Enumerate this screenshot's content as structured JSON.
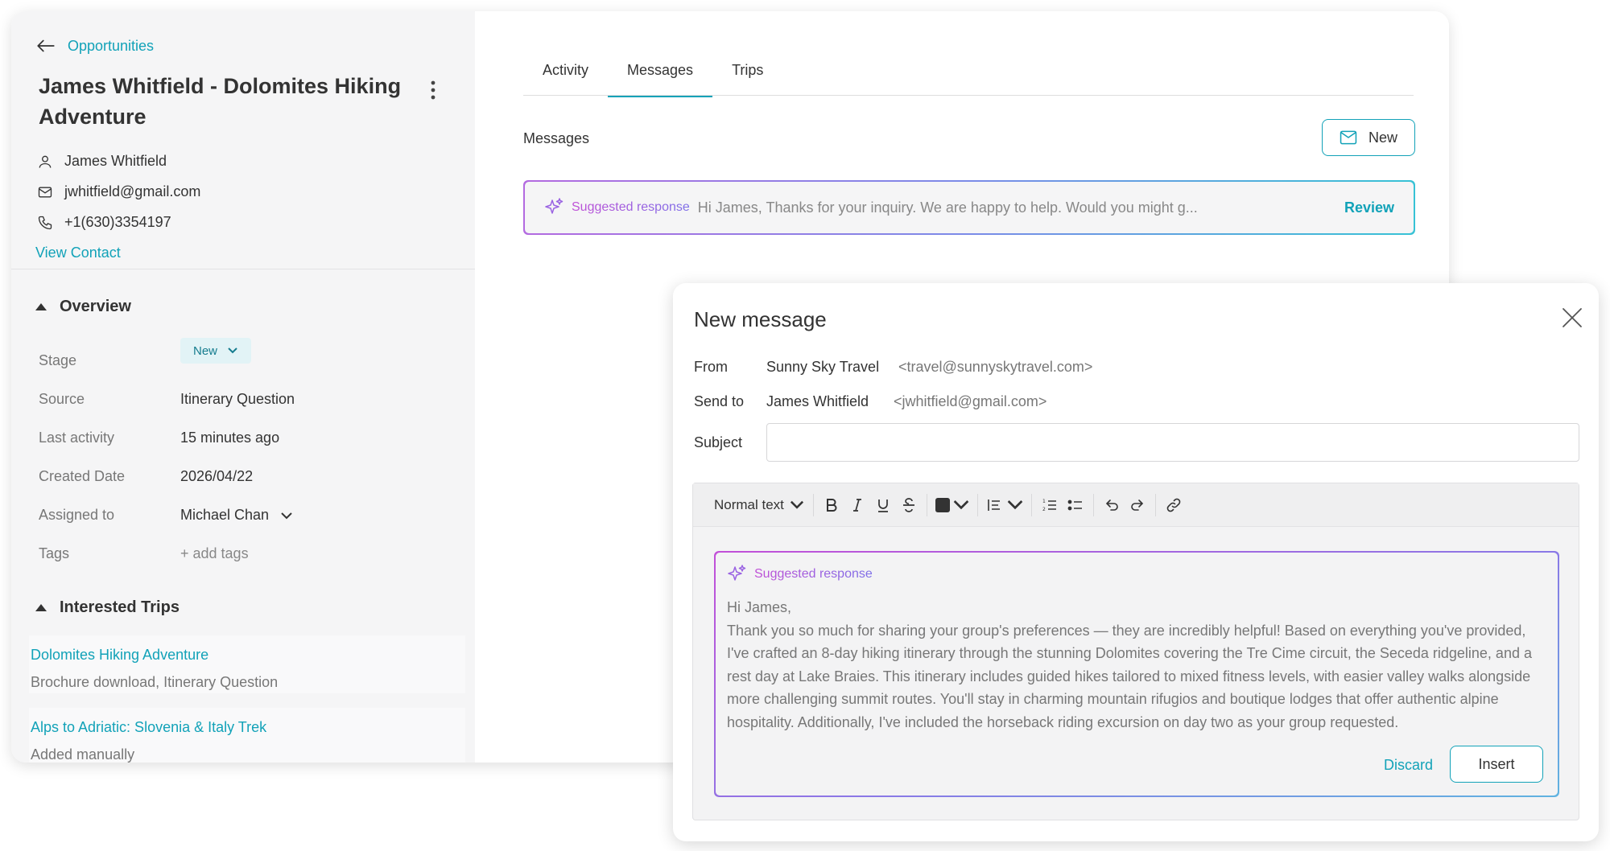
{
  "opportunity": {
    "back_label": "Opportunities",
    "title": "James Whitfield - Dolomites Hiking Adventure",
    "contact_name": "James Whitfield",
    "contact_email": "jwhitfield@gmail.com",
    "contact_phone": "+1(630)3354197",
    "view_contact_label": "View Contact"
  },
  "overview": {
    "heading": "Overview",
    "fields": [
      {
        "label": "Stage",
        "value": "New"
      },
      {
        "label": "Source",
        "value": "Itinerary Question"
      },
      {
        "label": "Last activity",
        "value": "15 minutes ago"
      },
      {
        "label": "Created Date",
        "value": "2026/04/22"
      },
      {
        "label": "Assigned to",
        "value": "Michael Chan"
      },
      {
        "label": "Tags",
        "value": "+ add tags"
      }
    ]
  },
  "interested_trips": {
    "heading": "Interested Trips",
    "items": [
      {
        "name": "Dolomites Hiking Adventure",
        "desc": "Brochure download, Itinerary Question"
      },
      {
        "name": "Alps to Adriatic: Slovenia & Italy Trek",
        "desc": "Added manually"
      }
    ]
  },
  "tabs": [
    {
      "label": "Activity"
    },
    {
      "label": "Messages"
    },
    {
      "label": "Trips"
    }
  ],
  "messages": {
    "heading": "Messages",
    "new_label": "New",
    "suggestion_label": "Suggested response",
    "suggestion_preview": "Hi James, Thanks for your inquiry. We are happy to help. Would you might g...",
    "review_label": "Review"
  },
  "dialog": {
    "title": "New message",
    "from_label": "From",
    "from_name": "Sunny Sky Travel",
    "from_email": "<travel@sunnyskytravel.com>",
    "to_label": "Send to",
    "to_name": "James Whitfield",
    "to_email": "<jwhitfield@gmail.com>",
    "subject_label": "Subject",
    "subject_value": "",
    "toolbar": {
      "format_label": "Normal text"
    },
    "suggestion_label": "Suggested response",
    "suggestion_greeting": "Hi James,",
    "suggestion_body": "Thank you so much for sharing your group's preferences — they are incredibly helpful! Based on everything you've provided, I've crafted an 8-day hiking itinerary through the stunning Dolomites covering the Tre Cime circuit, the Seceda ridgeline, and a rest day at Lake Braies. This itinerary includes guided hikes tailored to mixed fitness levels, with easier valley walks alongside more challenging summit routes. You'll stay in charming mountain rifugios and boutique lodges that offer authentic alpine hospitality. Additionally, I've included the horseback riding excursion on day two as your group requested.",
    "discard_label": "Discard",
    "insert_label": "Insert"
  },
  "colors": {
    "accent": "#12a2b8",
    "ai_gradient_start": "#c04fd6",
    "ai_gradient_end": "#37c2d5"
  }
}
